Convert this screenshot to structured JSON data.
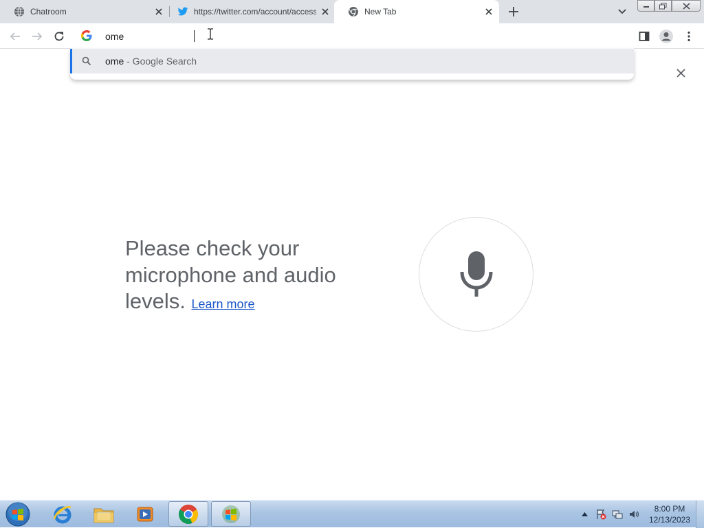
{
  "browser": {
    "tabs": [
      {
        "title": "Chatroom",
        "icon": "globe-icon"
      },
      {
        "title": "https://twitter.com/account/access",
        "icon": "twitter-bird-icon"
      },
      {
        "title": "New Tab",
        "icon": "chrome-icon",
        "active": true
      }
    ],
    "omnibox": {
      "value": "ome",
      "icon": "google-g-icon"
    },
    "suggestions": [
      {
        "query": "ome",
        "description": " - Google Search",
        "icon": "search-icon"
      }
    ]
  },
  "voice_search": {
    "message": "Please check your microphone and audio levels.",
    "link_text": "Learn more",
    "icon": "microphone-icon"
  },
  "taskbar": {
    "items": [
      "start-orb",
      "internet-explorer",
      "windows-explorer",
      "media-player",
      "google-chrome",
      "windows-app"
    ],
    "clock": {
      "time": "8:00 PM",
      "date": "12/13/2023"
    }
  },
  "colors": {
    "accent": "#1a73e8",
    "tabstrip": "#dee1e6",
    "suggestion_highlight": "#e8eaed",
    "text_secondary": "#5f6368",
    "link": "#1a56c8"
  }
}
